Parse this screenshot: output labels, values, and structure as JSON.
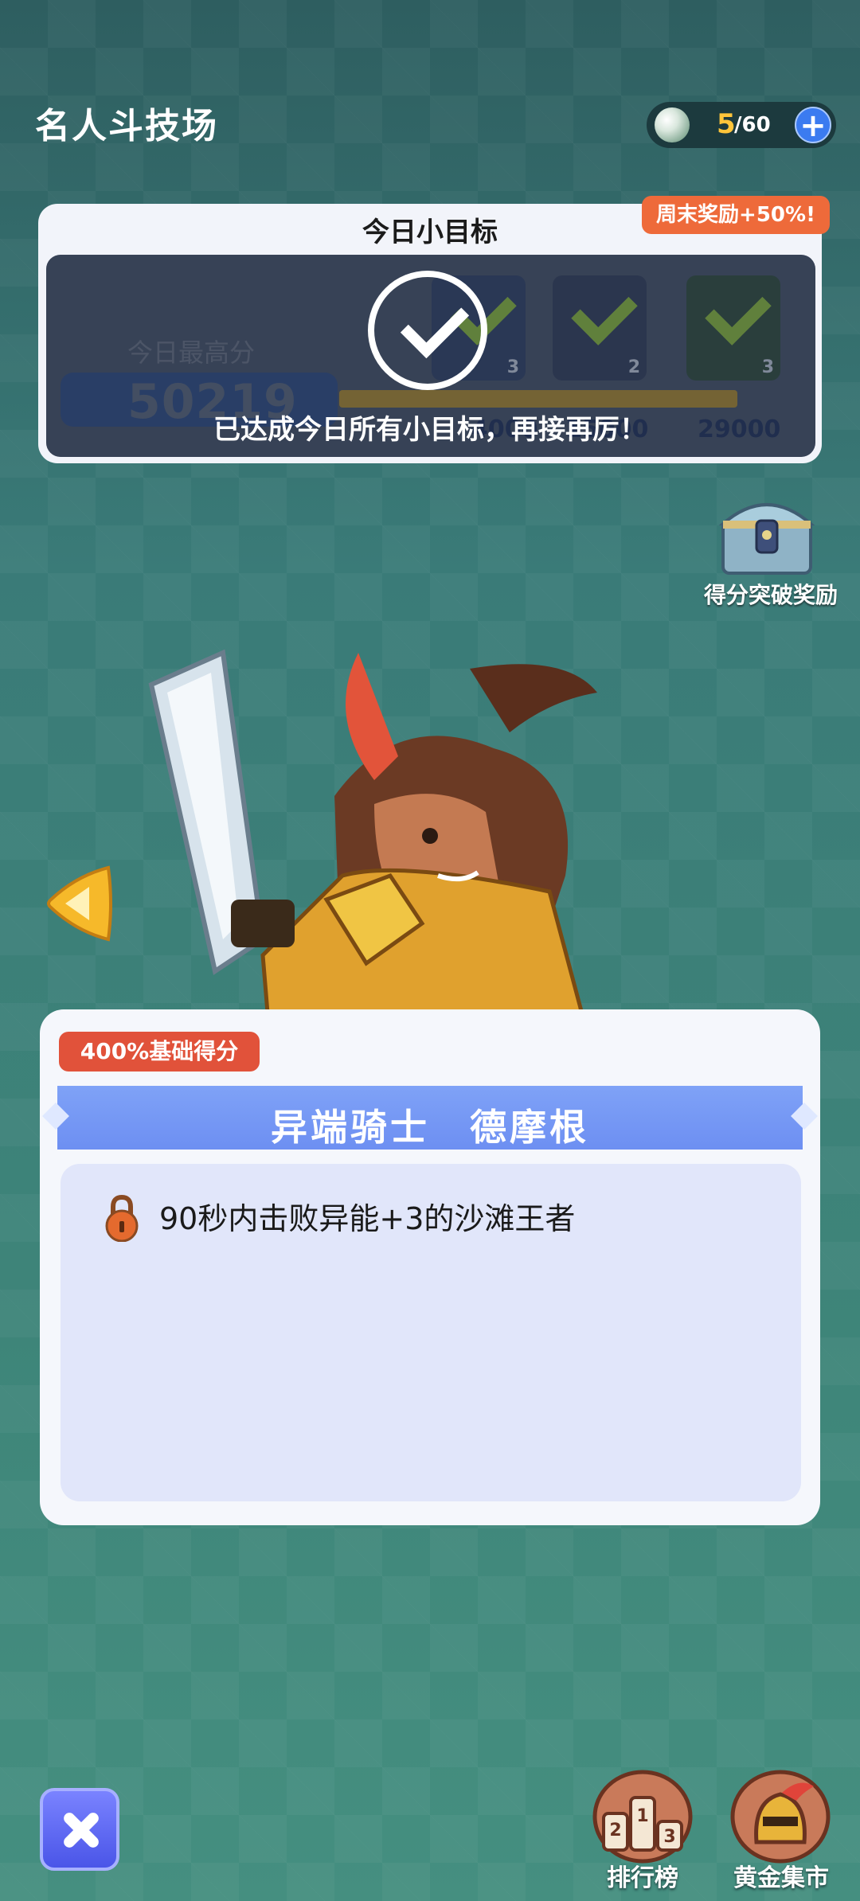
{
  "header": {
    "title": "名人斗技场"
  },
  "stamina": {
    "current": "5",
    "max": "/60",
    "gem_icon": "gem-icon",
    "add_icon": "plus-icon"
  },
  "daily_goal": {
    "title": "今日小目标",
    "weekend_bonus": "周末奖励+50%!",
    "best_label": "今日最高分",
    "best_score": "50219",
    "tiers": [
      {
        "count": "3",
        "achieved": true
      },
      {
        "count": "2",
        "achieved": true
      },
      {
        "count": "3",
        "achieved": true
      }
    ],
    "marks": [
      "4000",
      "15000",
      "29000"
    ],
    "completed_message": "已达成今日所有小目标，再接再厉！"
  },
  "score_break": {
    "label": "得分突破奖励"
  },
  "hero": {
    "base_score_tag": "400%基础得分",
    "name": "异端骑士　德摩根",
    "task": "90秒内击败异能+3的沙滩王者"
  },
  "bottom_nav": {
    "rank_label": "排行榜",
    "market_label": "黄金集市"
  },
  "colors": {
    "accent": "#3b7bf0",
    "badge": "#ee6a3a",
    "ribbon": "#7fa2f7"
  }
}
